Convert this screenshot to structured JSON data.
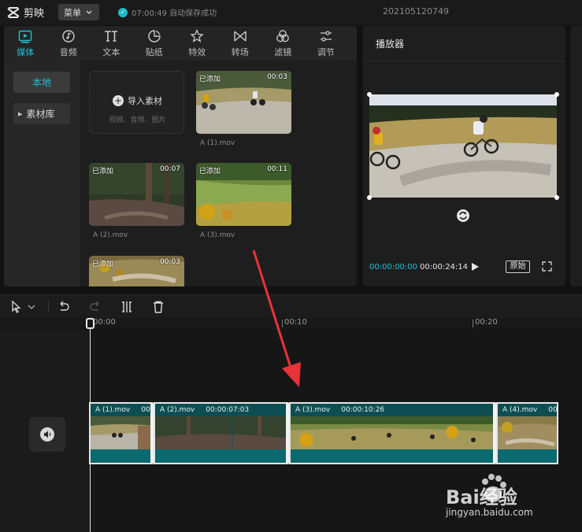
{
  "app": {
    "name": "剪映",
    "menu_label": "菜单",
    "autosave_text": "07:00:49 自动保存成功",
    "project_name": "202105120749"
  },
  "tabs": [
    {
      "label": "媒体",
      "icon": "media-icon",
      "active": true
    },
    {
      "label": "音频",
      "icon": "audio-icon"
    },
    {
      "label": "文本",
      "icon": "text-icon"
    },
    {
      "label": "贴纸",
      "icon": "sticker-icon"
    },
    {
      "label": "特效",
      "icon": "effects-icon"
    },
    {
      "label": "转场",
      "icon": "transition-icon"
    },
    {
      "label": "滤镜",
      "icon": "filter-icon"
    },
    {
      "label": "调节",
      "icon": "adjust-icon"
    }
  ],
  "sidebar": {
    "local": "本地",
    "library": "素材库"
  },
  "import": {
    "label": "导入素材",
    "hint": "视频、音频、图片"
  },
  "media_clips": [
    {
      "badge": "已添加",
      "duration": "00:03",
      "name": "A (1).mov"
    },
    {
      "badge": "已添加",
      "duration": "00:07",
      "name": "A (2).mov"
    },
    {
      "badge": "已添加",
      "duration": "00:11",
      "name": "A (3).mov"
    },
    {
      "badge": "已添加",
      "duration": "00:03",
      "name": ""
    }
  ],
  "player": {
    "title": "播放器",
    "current_time": "00:00:00:00",
    "total_time": "00:00:24:14",
    "original_label": "原始"
  },
  "timeline": {
    "ruler_labels": [
      "00:00",
      "00:10",
      "00:20"
    ],
    "clips": [
      {
        "name": "A (1).mov",
        "duration": "00"
      },
      {
        "name": "A (2).mov",
        "duration": "00:00:07:03"
      },
      {
        "name": "A (3).mov",
        "duration": "00:00:10:26"
      },
      {
        "name": "A (4).mov",
        "duration": "00"
      }
    ]
  },
  "watermark": {
    "brand": "Bai经验",
    "url": "jingyan.baidu.com"
  },
  "colors": {
    "accent": "#1fc3d6",
    "track": "#0e4e52",
    "arrow": "#e8333a"
  }
}
